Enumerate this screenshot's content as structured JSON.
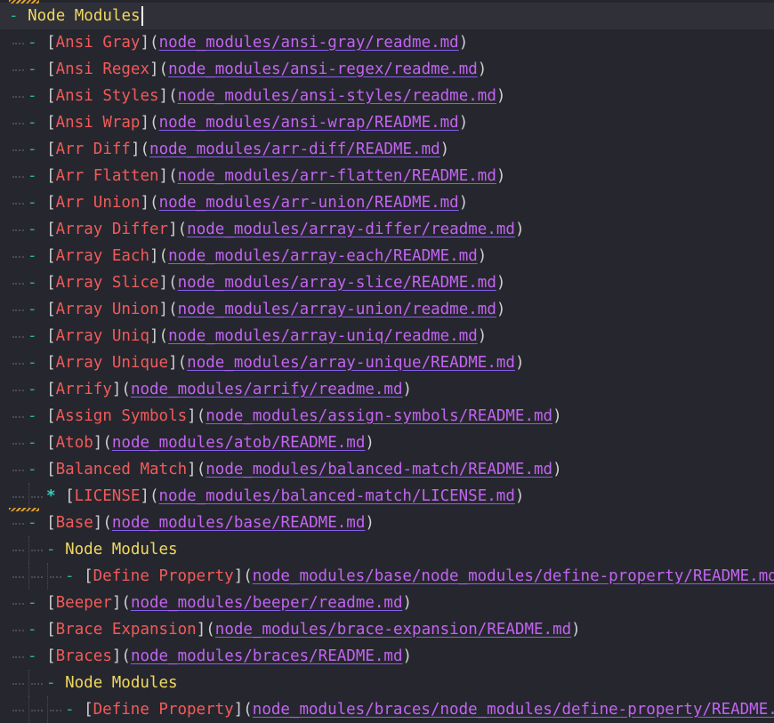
{
  "editor": {
    "lines": [
      {
        "depth": 0,
        "type": "heading",
        "bullet": "-",
        "text": "Node Modules",
        "current": true,
        "cursor": true
      },
      {
        "depth": 1,
        "type": "link",
        "bullet": "-",
        "label": "Ansi Gray",
        "url": "node_modules/ansi-gray/readme.md"
      },
      {
        "depth": 1,
        "type": "link",
        "bullet": "-",
        "label": "Ansi Regex",
        "url": "node_modules/ansi-regex/readme.md"
      },
      {
        "depth": 1,
        "type": "link",
        "bullet": "-",
        "label": "Ansi Styles",
        "url": "node_modules/ansi-styles/readme.md"
      },
      {
        "depth": 1,
        "type": "link",
        "bullet": "-",
        "label": "Ansi Wrap",
        "url": "node_modules/ansi-wrap/README.md"
      },
      {
        "depth": 1,
        "type": "link",
        "bullet": "-",
        "label": "Arr Diff",
        "url": "node_modules/arr-diff/README.md"
      },
      {
        "depth": 1,
        "type": "link",
        "bullet": "-",
        "label": "Arr Flatten",
        "url": "node_modules/arr-flatten/README.md"
      },
      {
        "depth": 1,
        "type": "link",
        "bullet": "-",
        "label": "Arr Union",
        "url": "node_modules/arr-union/README.md"
      },
      {
        "depth": 1,
        "type": "link",
        "bullet": "-",
        "label": "Array Differ",
        "url": "node_modules/array-differ/readme.md"
      },
      {
        "depth": 1,
        "type": "link",
        "bullet": "-",
        "label": "Array Each",
        "url": "node_modules/array-each/README.md"
      },
      {
        "depth": 1,
        "type": "link",
        "bullet": "-",
        "label": "Array Slice",
        "url": "node_modules/array-slice/README.md"
      },
      {
        "depth": 1,
        "type": "link",
        "bullet": "-",
        "label": "Array Union",
        "url": "node_modules/array-union/readme.md"
      },
      {
        "depth": 1,
        "type": "link",
        "bullet": "-",
        "label": "Array Uniq",
        "url": "node_modules/array-uniq/readme.md"
      },
      {
        "depth": 1,
        "type": "link",
        "bullet": "-",
        "label": "Array Unique",
        "url": "node_modules/array-unique/README.md"
      },
      {
        "depth": 1,
        "type": "link",
        "bullet": "-",
        "label": "Arrify",
        "url": "node_modules/arrify/readme.md"
      },
      {
        "depth": 1,
        "type": "link",
        "bullet": "-",
        "label": "Assign Symbols",
        "url": "node_modules/assign-symbols/README.md"
      },
      {
        "depth": 1,
        "type": "link",
        "bullet": "-",
        "label": "Atob",
        "url": "node_modules/atob/README.md"
      },
      {
        "depth": 1,
        "type": "link",
        "bullet": "-",
        "label": "Balanced Match",
        "url": "node_modules/balanced-match/README.md"
      },
      {
        "depth": 2,
        "type": "link",
        "bullet": "*",
        "label": "LICENSE",
        "url": "node_modules/balanced-match/LICENSE.md",
        "squiggle": true
      },
      {
        "depth": 1,
        "type": "link",
        "bullet": "-",
        "label": "Base",
        "url": "node_modules/base/README.md"
      },
      {
        "depth": 2,
        "type": "heading",
        "bullet": "-",
        "text": "Node Modules"
      },
      {
        "depth": 3,
        "type": "link",
        "bullet": "-",
        "label": "Define Property",
        "url": "node_modules/base/node_modules/define-property/README.md"
      },
      {
        "depth": 1,
        "type": "link",
        "bullet": "-",
        "label": "Beeper",
        "url": "node_modules/beeper/readme.md"
      },
      {
        "depth": 1,
        "type": "link",
        "bullet": "-",
        "label": "Brace Expansion",
        "url": "node_modules/brace-expansion/README.md"
      },
      {
        "depth": 1,
        "type": "link",
        "bullet": "-",
        "label": "Braces",
        "url": "node_modules/braces/README.md"
      },
      {
        "depth": 2,
        "type": "heading",
        "bullet": "-",
        "text": "Node Modules"
      },
      {
        "depth": 3,
        "type": "link",
        "bullet": "-",
        "label": "Define Property",
        "url": "node_modules/braces/node_modules/define-property/README.md"
      }
    ]
  },
  "colors": {
    "background": "#26272e",
    "bullet": "#2bb38a",
    "link_text": "#f25a5a",
    "link_url": "#c264f2",
    "heading": "#f0d860"
  }
}
